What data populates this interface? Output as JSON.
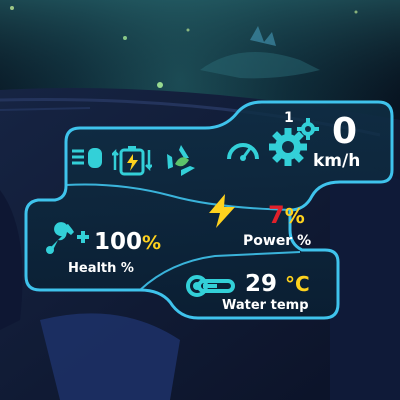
{
  "hud": {
    "gear": "1",
    "speed_value": "0",
    "speed_unit": "km/h",
    "power_value": "7",
    "power_unit": "%",
    "power_label": "Power %",
    "health_value": "100",
    "health_unit": "%",
    "health_label": "Health %",
    "water_temp_value": "29",
    "water_temp_unit": "°C",
    "water_temp_label": "Water temp"
  },
  "icons": {
    "headlight": "headlight-icon",
    "battery_swap": "battery-swap-icon",
    "recycle": "recycle-icon",
    "speedometer": "speedometer-icon",
    "gears": "gears-icon",
    "lightning": "lightning-icon",
    "wrench_plus": "wrench-plus-icon",
    "thermometer": "thermometer-icon"
  },
  "colors": {
    "panel_border": "#3fc3ec",
    "accent_cyan": "#33d0d8",
    "percent_yellow": "#ffd21e",
    "power_red": "#e0202a",
    "celsius_yellow": "#ffd21e",
    "recycle_green": "#5cc36a"
  }
}
